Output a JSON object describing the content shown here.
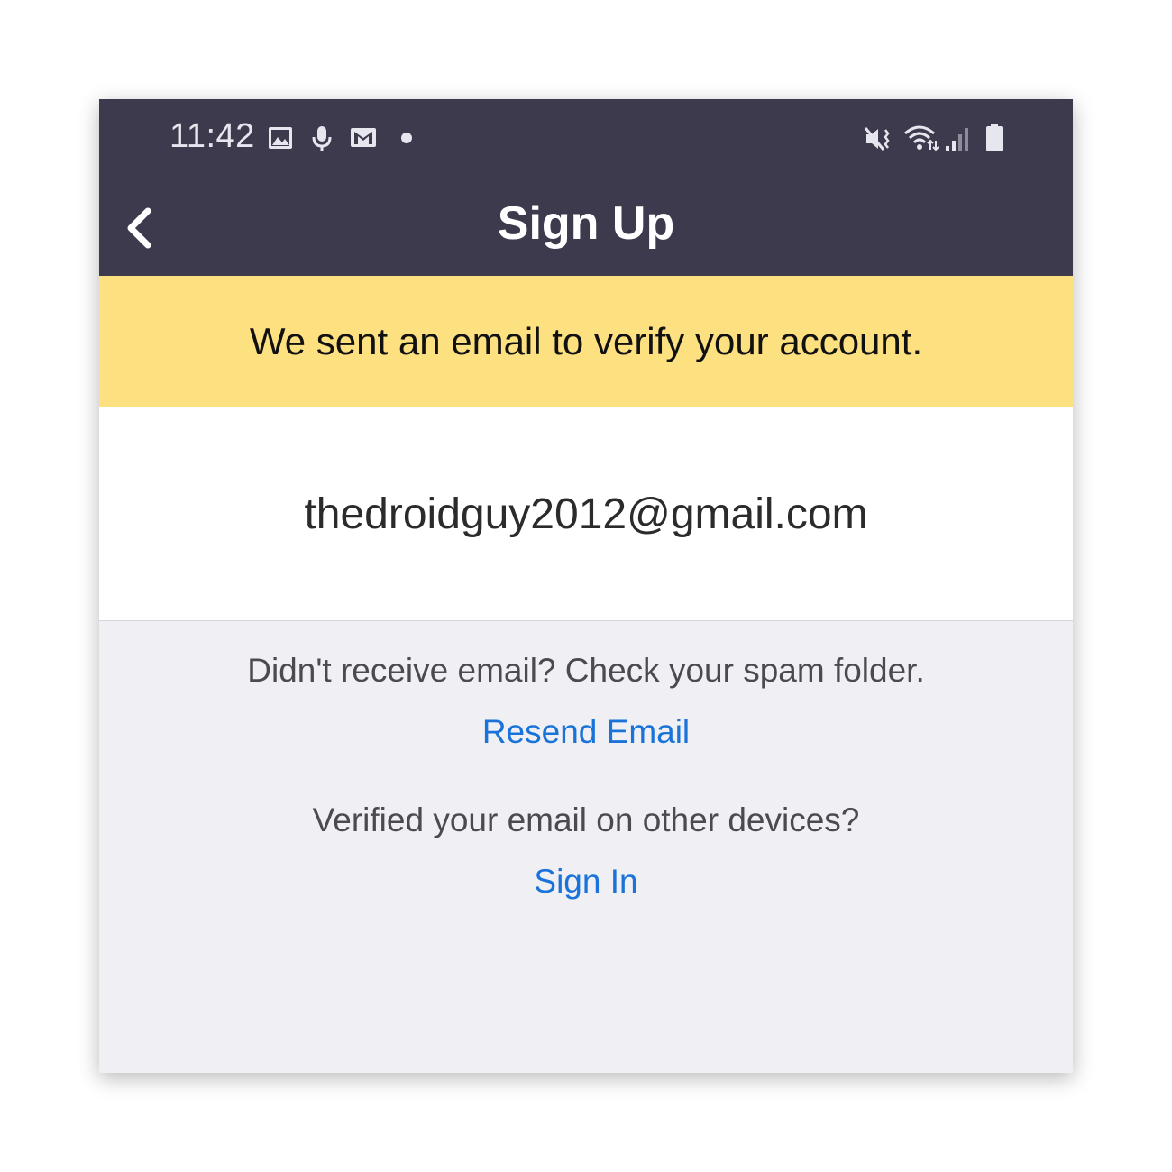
{
  "status_bar": {
    "time": "11:42",
    "left_icons": [
      "gallery-icon",
      "microphone-icon",
      "gmail-icon",
      "notification-dot-icon"
    ],
    "right_icons": [
      "vibrate-mute-icon",
      "wifi-icon",
      "signal-icon",
      "battery-icon"
    ]
  },
  "nav": {
    "title": "Sign Up",
    "back_icon": "chevron-left-icon"
  },
  "banner": {
    "message": "We sent an email to verify your account."
  },
  "email": {
    "address": "thedroidguy2012@gmail.com"
  },
  "help": {
    "spam_text": "Didn't receive email? Check your spam folder.",
    "resend_label": "Resend Email",
    "other_devices_text": "Verified your email on other devices?",
    "sign_in_label": "Sign In"
  },
  "colors": {
    "header_bg": "#3d3a4e",
    "banner_bg": "#fde07f",
    "link": "#1a73d9",
    "page_bg": "#efeff4"
  }
}
